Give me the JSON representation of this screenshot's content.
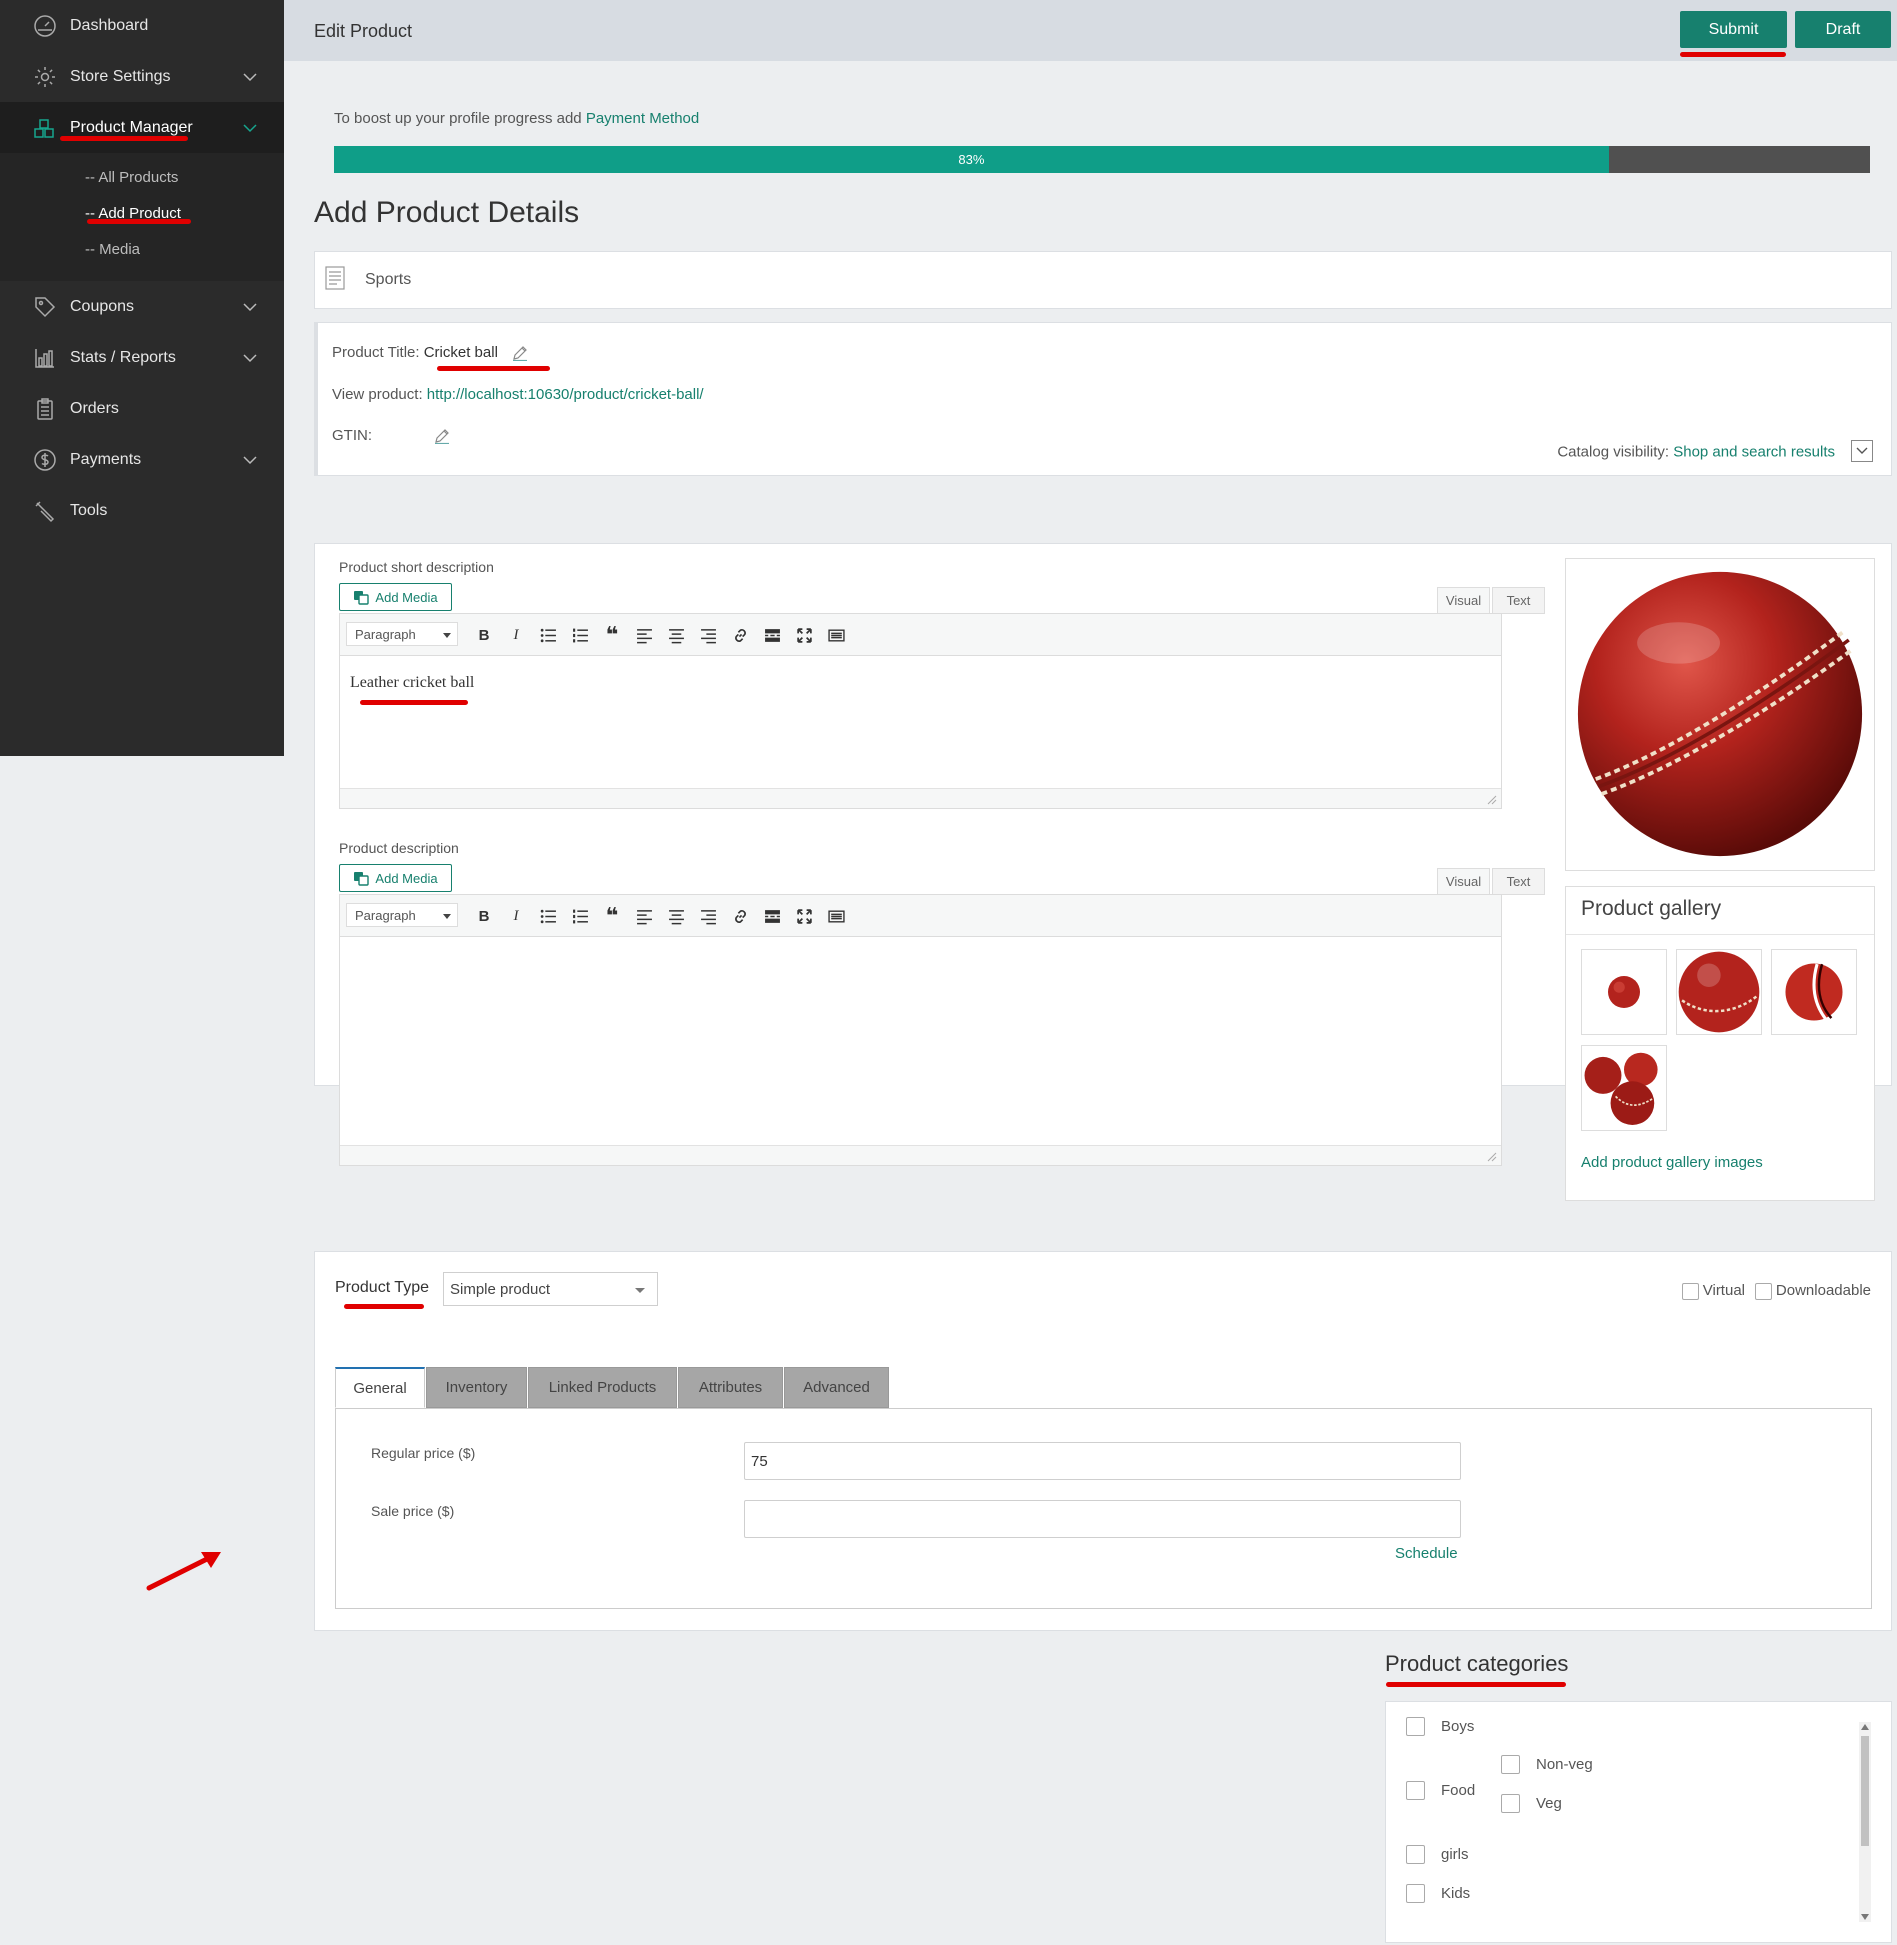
{
  "sidebar": {
    "items": [
      {
        "label": "Dashboard",
        "icon": "dashboard-icon"
      },
      {
        "label": "Store Settings",
        "icon": "gear-icon"
      },
      {
        "label": "Product Manager",
        "icon": "boxes-icon"
      },
      {
        "label": "Coupons",
        "icon": "tag-icon"
      },
      {
        "label": "Stats / Reports",
        "icon": "bar-chart-icon"
      },
      {
        "label": "Orders",
        "icon": "clipboard-icon"
      },
      {
        "label": "Payments",
        "icon": "dollar-icon"
      },
      {
        "label": "Tools",
        "icon": "wrench-icon"
      }
    ],
    "submenu": [
      "-- All Products",
      "-- Add Product",
      "-- Media"
    ]
  },
  "header": {
    "title": "Edit Product",
    "submit_label": "Submit",
    "draft_label": "Draft"
  },
  "profile": {
    "text": "To boost up your profile progress add",
    "link": "Payment Method",
    "progress_label": "83%",
    "progress_value": 83
  },
  "section_title": "Add Product Details",
  "category_bar": {
    "value": "Sports"
  },
  "product": {
    "title_label": "Product Title:",
    "title_value": "Cricket ball",
    "view_label": "View product:",
    "view_url": "http://localhost:10630/product/cricket-ball/",
    "gtin_label": "GTIN:",
    "visibility_label": "Catalog visibility:",
    "visibility_value": "Shop and search results"
  },
  "short_description": {
    "label": "Product short description",
    "add_media": "Add Media",
    "tab_visual": "Visual",
    "tab_text": "Text",
    "format": "Paragraph",
    "content": "Leather cricket ball"
  },
  "description": {
    "label": "Product description",
    "add_media": "Add Media",
    "tab_visual": "Visual",
    "tab_text": "Text",
    "format": "Paragraph",
    "content": ""
  },
  "gallery": {
    "title": "Product gallery",
    "add_label": "Add product gallery images"
  },
  "product_type": {
    "label": "Product Type",
    "value": "Simple product",
    "virtual_label": "Virtual",
    "downloadable_label": "Downloadable"
  },
  "tabs": [
    "General",
    "Inventory",
    "Linked Products",
    "Attributes",
    "Advanced"
  ],
  "pricing": {
    "regular_label": "Regular price ($)",
    "regular_value": "75",
    "sale_label": "Sale price ($)",
    "sale_value": "",
    "schedule_label": "Schedule"
  },
  "categories": {
    "title": "Product categories",
    "items": [
      "Boys",
      "Food",
      "Non-veg",
      "Veg",
      "girls",
      "Kids"
    ]
  },
  "colors": {
    "accent": "#17806e",
    "sidebar_bg": "#2b2b2b",
    "progress_fill": "#0f9e88",
    "annotation": "#e00000"
  }
}
